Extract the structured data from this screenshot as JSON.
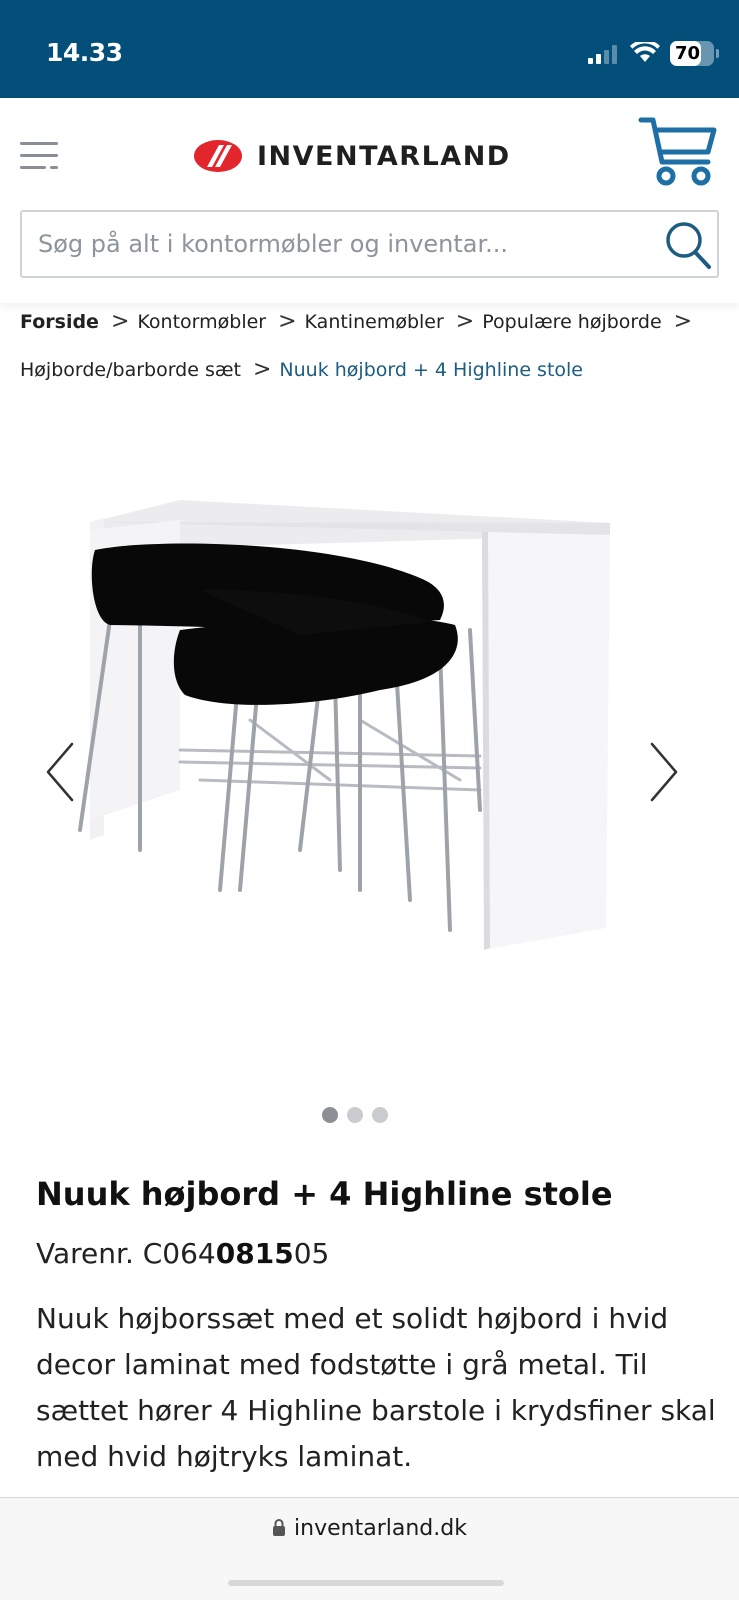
{
  "status_bar": {
    "time": "14.33",
    "battery": "70",
    "battery_level": 0.7,
    "background_color": "#044f7a"
  },
  "header": {
    "menu_icon": "hamburger-menu-icon",
    "logo_text": "INVENTARLAND",
    "cart_icon": "shopping-cart-icon",
    "brand_color": "#044f7a"
  },
  "search": {
    "placeholder": "Søg på alt i kontormøbler og inventar...",
    "value": "",
    "icon": "search-icon"
  },
  "breadcrumb": {
    "items": [
      "Forside",
      "Kontormøbler",
      "Kantinemøbler",
      "Populære højborde",
      "Højborde/barborde sæt",
      "Nuuk højbord + 4 Highline stole"
    ],
    "current_color": "#1d5c82"
  },
  "gallery": {
    "image_alt": "product-photo",
    "prev_icon": "chevron-left-icon",
    "next_icon": "chevron-right-icon",
    "dot_count": 3,
    "active_index": 0
  },
  "product": {
    "title": "Nuuk højbord + 4 Highline stole",
    "sku_label": "Varenr. ",
    "sku_prefix": "C064",
    "sku_bold": "0815",
    "sku_suffix": "05",
    "description": "Nuuk højborssæt med et solidt højbord i hvid decor laminat med fodstøtte i grå metal. Til sættet hører 4 Highline barstole i krydsfiner skal med hvid højtryks laminat."
  },
  "browser": {
    "url": "inventarland.dk",
    "lock_icon": "lock-icon"
  }
}
